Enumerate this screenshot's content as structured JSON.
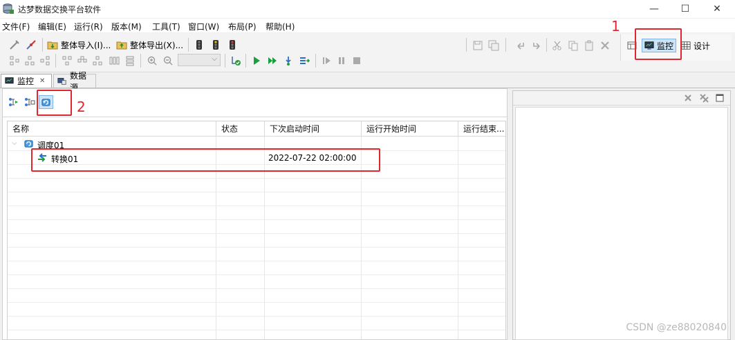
{
  "window": {
    "title": "达梦数据交换平台软件",
    "minimize_glyph": "—",
    "maximize_glyph": "☐",
    "close_glyph": "✕"
  },
  "menu": [
    {
      "label": "文件(F)"
    },
    {
      "label": "编辑(E)"
    },
    {
      "label": "运行(R)"
    },
    {
      "label": "版本(M)"
    },
    {
      "label": "工具(T)"
    },
    {
      "label": "窗口(W)"
    },
    {
      "label": "布局(P)"
    },
    {
      "label": "帮助(H)"
    }
  ],
  "toolbar": {
    "import_label": "整体导入(I)...",
    "export_label": "整体导出(X)..."
  },
  "perspectives": {
    "monitor_label": "监控",
    "design_label": "设计"
  },
  "tabs": [
    {
      "label": "监控",
      "close_glyph": "✕"
    },
    {
      "label": "数据源"
    }
  ],
  "table": {
    "columns": [
      "名称",
      "状态",
      "下次启动时间",
      "运行开始时间",
      "运行结束..."
    ],
    "rows": [
      {
        "name": "调度01",
        "status": "",
        "next_start": "",
        "run_start": "",
        "run_end": ""
      },
      {
        "name": "转换01",
        "status": "",
        "next_start": "2022-07-22 02:00:00",
        "run_start": "",
        "run_end": ""
      }
    ]
  },
  "annotations": {
    "label_1": "1",
    "label_2": "2"
  },
  "watermark": "CSDN @ze88020840",
  "colors": {
    "annotation_red": "#e0262c",
    "selection_blue": "#cce4f7"
  }
}
